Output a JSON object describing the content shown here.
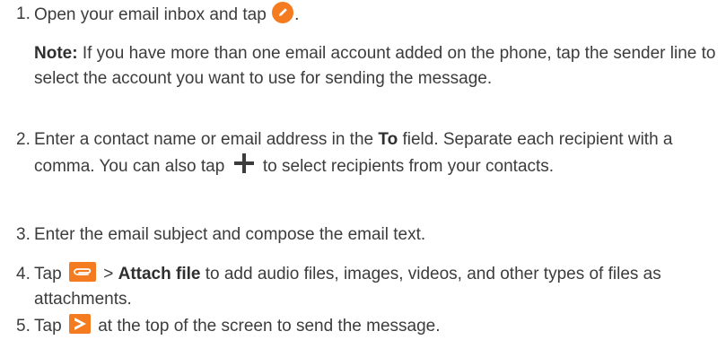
{
  "steps": [
    {
      "number": "1.",
      "text_before": "Open your email inbox and tap",
      "icon": "compose-pencil-icon",
      "text_after": "."
    },
    {
      "note_label": "Note:",
      "note_text": "If you have more than one email account added on the phone, tap the sender line to select the account you want to use for sending the message."
    },
    {
      "number": "2.",
      "text_1": "Enter a contact name or email address in the",
      "bold_1": "To",
      "text_2": "field. Separate each recipient with a comma. You can also tap",
      "icon": "plus-icon",
      "text_3": "to select recipients from your contacts."
    },
    {
      "number": "3.",
      "text": "Enter the email subject and compose the email text."
    },
    {
      "number": "4.",
      "text_1": "Tap",
      "icon": "attach-paperclip-icon",
      "text_2": ">",
      "bold_1": "Attach file",
      "text_3": "to add audio files, images, videos, and other types of files as attachments."
    },
    {
      "number": "5.",
      "text_1": "Tap",
      "icon": "send-icon",
      "text_2": "at the top of the screen to send the message."
    }
  ],
  "colors": {
    "accent": "#f47b20",
    "text": "#3c3c3c"
  }
}
